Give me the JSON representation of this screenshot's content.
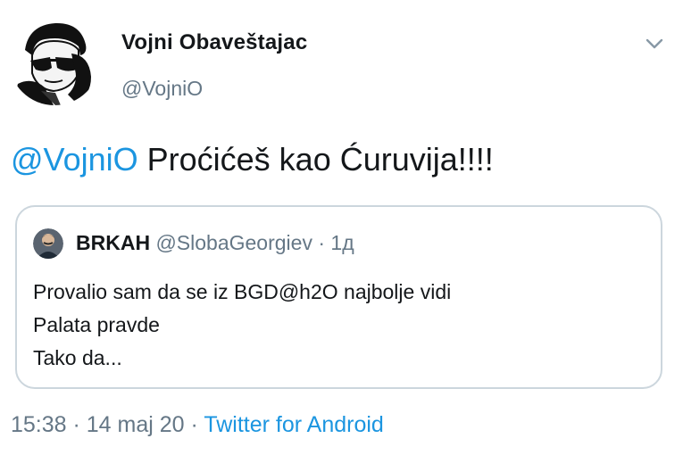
{
  "author": {
    "display_name": "Vojni Obaveštajac",
    "handle": "@VojniO",
    "avatar": "man-with-sunglasses-avatar"
  },
  "tweet": {
    "mention": "@VojniO",
    "text": " Proćićeš kao Ćuruvija!!!!"
  },
  "quoted_tweet": {
    "author_name": "BRKAH",
    "handle": "@SlobaGeorgiev",
    "separator": " · ",
    "time": "1д",
    "lines": [
      "Provalio sam da se iz BGD@h2O najbolje vidi",
      "Palata pravde",
      "Tako da..."
    ]
  },
  "footer": {
    "time": "15:38",
    "separator": " · ",
    "date": "14 maj 20",
    "source": "Twitter for Android"
  },
  "icons": {
    "menu": "chevron-down-icon"
  },
  "colors": {
    "link": "#1b95e0",
    "secondary_text": "#657786",
    "border": "#ccd6dd"
  }
}
